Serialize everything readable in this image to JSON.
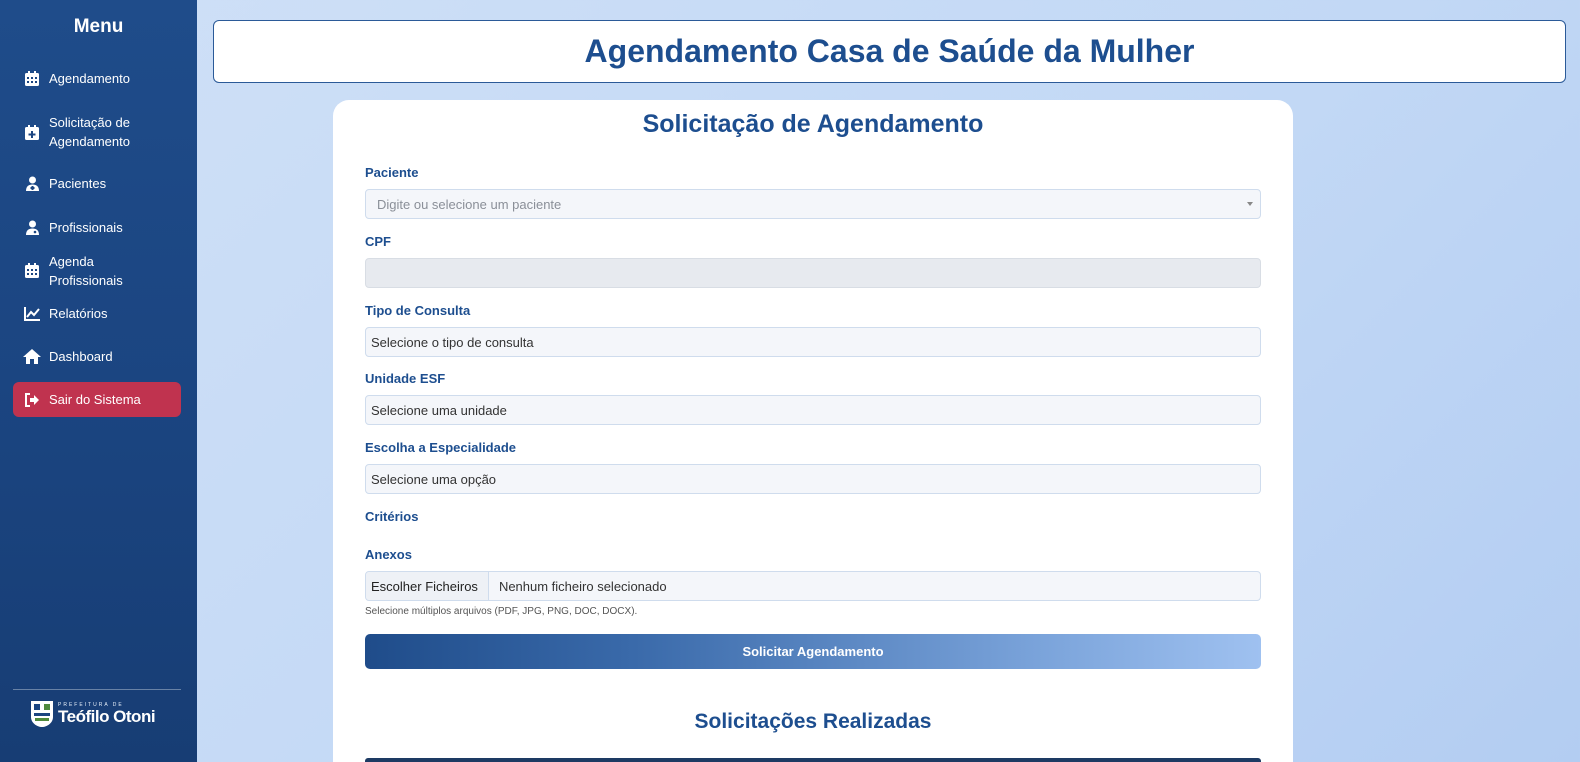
{
  "sidebar": {
    "title": "Menu",
    "items": [
      {
        "label": "Agendamento",
        "icon": "calendar-icon"
      },
      {
        "label": "Solicitação de Agendamento",
        "icon": "calendar-plus-icon"
      },
      {
        "label": "Pacientes",
        "icon": "user-medical-icon"
      },
      {
        "label": "Profissionais",
        "icon": "user-doctor-icon"
      },
      {
        "label": "Agenda Profissionais",
        "icon": "calendar-icon"
      },
      {
        "label": "Relatórios",
        "icon": "chart-line-icon"
      },
      {
        "label": "Dashboard",
        "icon": "home-icon"
      },
      {
        "label": "Sair do Sistema",
        "icon": "sign-out-icon"
      }
    ],
    "logo": {
      "small": "PREFEITURA DE",
      "big": "Teófilo Otoni"
    }
  },
  "header": {
    "title": "Agendamento Casa de Saúde da Mulher"
  },
  "form": {
    "title": "Solicitação de Agendamento",
    "paciente": {
      "label": "Paciente",
      "placeholder": "Digite ou selecione um paciente"
    },
    "cpf": {
      "label": "CPF",
      "value": ""
    },
    "tipo_consulta": {
      "label": "Tipo de Consulta",
      "value": "Selecione o tipo de consulta"
    },
    "unidade": {
      "label": "Unidade ESF",
      "value": "Selecione uma unidade"
    },
    "especialidade": {
      "label": "Escolha a Especialidade",
      "value": "Selecione uma opção"
    },
    "criterios": {
      "label": "Critérios"
    },
    "anexos": {
      "label": "Anexos",
      "button": "Escolher Ficheiros",
      "status": "Nenhum ficheiro selecionado",
      "help": "Selecione múltiplos arquivos (PDF, JPG, PNG, DOC, DOCX)."
    },
    "submit": "Solicitar Agendamento"
  },
  "requests": {
    "title": "Solicitações Realizadas"
  },
  "colors": {
    "primary": "#1d4e8f",
    "sidebar": "#1b4581",
    "logout": "#c0334f"
  }
}
